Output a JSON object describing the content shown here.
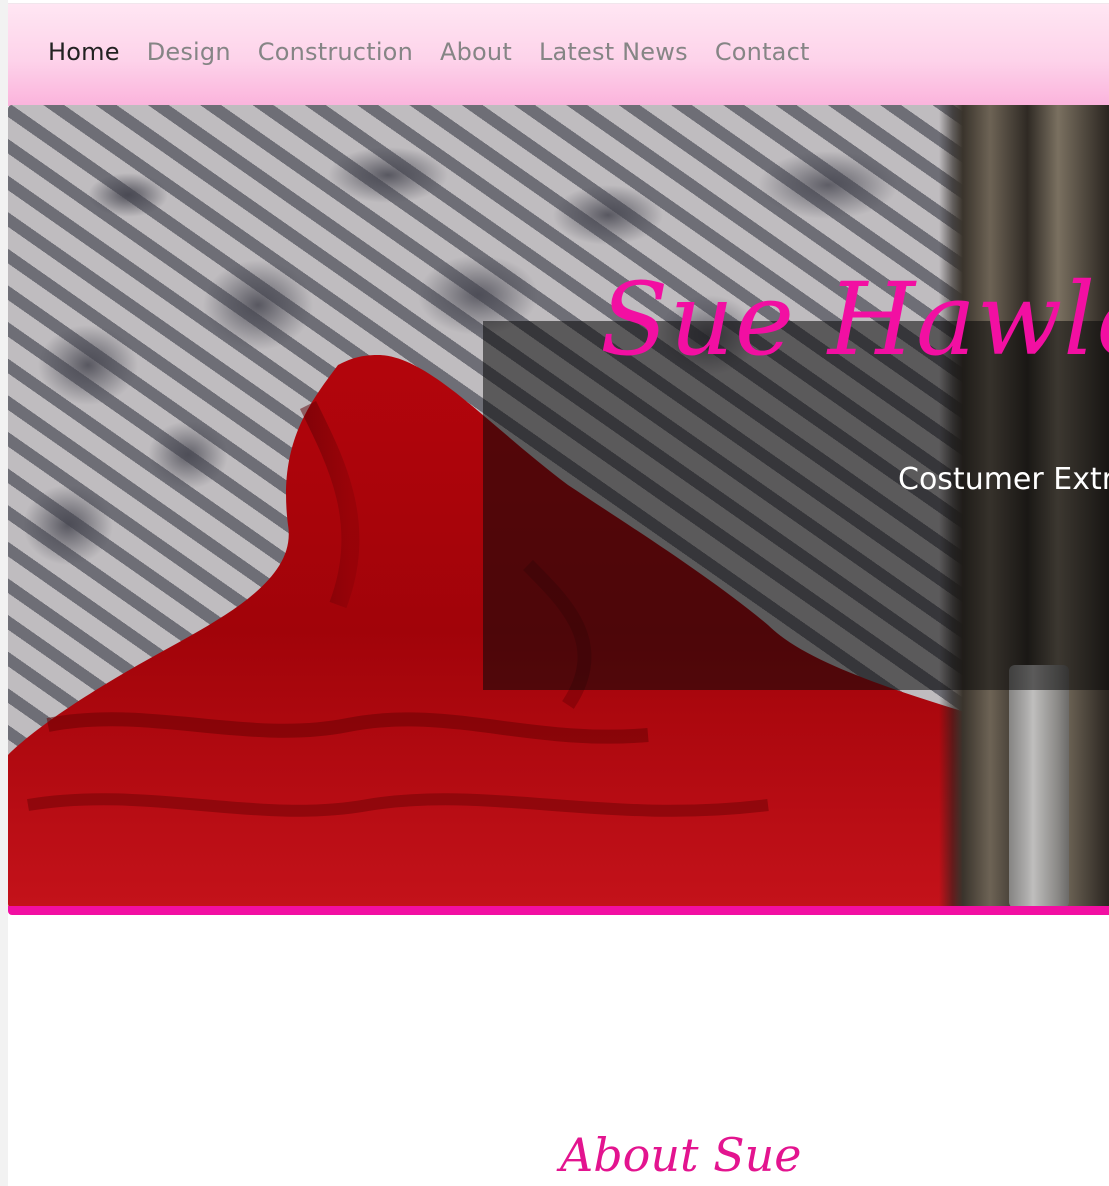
{
  "nav": {
    "items": [
      {
        "label": "Home",
        "active": true
      },
      {
        "label": "Design",
        "active": false
      },
      {
        "label": "Construction",
        "active": false
      },
      {
        "label": "About",
        "active": false
      },
      {
        "label": "Latest News",
        "active": false
      },
      {
        "label": "Contact",
        "active": false
      }
    ]
  },
  "hero": {
    "title": "Sue Hawle",
    "subtitle": "Costumer Extr"
  },
  "about": {
    "heading": "About Sue"
  },
  "colors": {
    "accent": "#f20fa2",
    "nav_gradient_top": "#ffe6f3",
    "nav_gradient_bottom": "#fbb3dc",
    "nav_text": "#858585",
    "nav_text_active": "#222222"
  }
}
